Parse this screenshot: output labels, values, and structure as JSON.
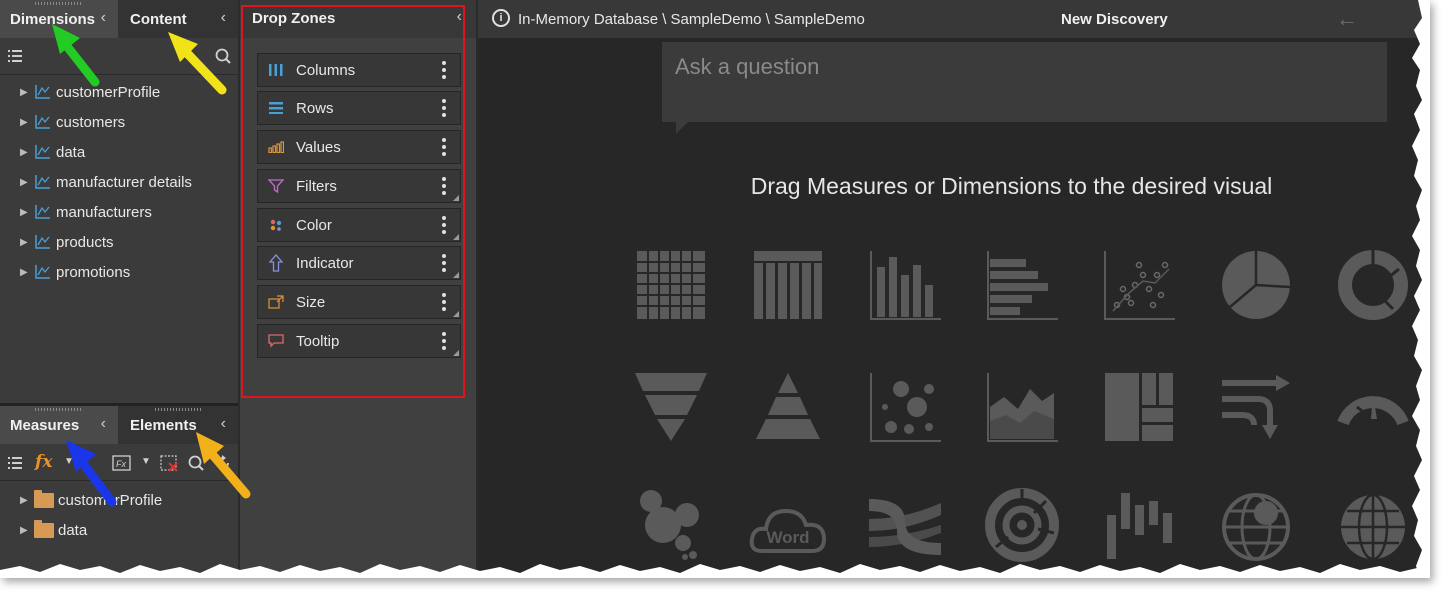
{
  "left_top_panel": {
    "tabs": [
      {
        "label": "Dimensions",
        "active": true
      },
      {
        "label": "Content",
        "active": false
      }
    ],
    "collapse_icon": "chevron-left-icon",
    "tools": [
      "list-icon",
      "search-icon"
    ],
    "tree": [
      {
        "label": "customerProfile",
        "icon": "dimension-icon"
      },
      {
        "label": "customers",
        "icon": "dimension-icon"
      },
      {
        "label": "data",
        "icon": "dimension-icon"
      },
      {
        "label": "manufacturer details",
        "icon": "dimension-icon"
      },
      {
        "label": "manufacturers",
        "icon": "dimension-icon"
      },
      {
        "label": "products",
        "icon": "dimension-icon"
      },
      {
        "label": "promotions",
        "icon": "dimension-icon"
      }
    ]
  },
  "left_bottom_panel": {
    "tabs": [
      {
        "label": "Measures",
        "active": true
      },
      {
        "label": "Elements",
        "active": false
      }
    ],
    "tools": [
      "list-icon",
      "fx-icon",
      "dropdown-icon",
      "fx-box-icon",
      "dropdown-icon",
      "delete-icon",
      "search-icon",
      "refresh-icon"
    ],
    "tree": [
      {
        "label": "customerProfile",
        "icon": "folder-icon"
      },
      {
        "label": "data",
        "icon": "folder-icon"
      }
    ]
  },
  "drop_zones": {
    "title": "Drop Zones",
    "zones": [
      {
        "label": "Columns",
        "icon": "columns-icon",
        "color": "#4a9fd8"
      },
      {
        "label": "Rows",
        "icon": "rows-icon",
        "color": "#4a9fd8"
      },
      {
        "label": "Values",
        "icon": "values-icon",
        "color": "#e0943a"
      },
      {
        "label": "Filters",
        "icon": "filter-icon",
        "color": "#c46ccf"
      },
      {
        "label": "Color",
        "icon": "color-icon",
        "color": "#d96b6b"
      },
      {
        "label": "Indicator",
        "icon": "indicator-icon",
        "color": "#8a8fe0"
      },
      {
        "label": "Size",
        "icon": "size-icon",
        "color": "#e0943a"
      },
      {
        "label": "Tooltip",
        "icon": "tooltip-icon",
        "color": "#e06a6a"
      }
    ]
  },
  "header": {
    "path": "In-Memory Database \\ SampleDemo \\ SampleDemo",
    "title": "New Discovery"
  },
  "ask": {
    "placeholder": "Ask a question"
  },
  "hint": "Drag Measures or Dimensions to the desired visual",
  "visuals": [
    "grid-icon",
    "pivot-icon",
    "column-chart-icon",
    "bar-chart-icon",
    "scatter-icon",
    "pie-icon",
    "donut-icon",
    "funnel-icon",
    "pyramid-icon",
    "bubble-icon",
    "area-icon",
    "treemap-icon",
    "flow-icon",
    "gauge-icon",
    "packed-bubble-icon",
    "word-cloud-icon",
    "sankey-icon",
    "sunburst-icon",
    "waterfall-icon",
    "globe-bubble-icon",
    "globe-icon"
  ],
  "word_cloud_text": "Word",
  "annotations": {
    "arrow_colors": [
      "#22cc22",
      "#f2e21a",
      "#1a36e8",
      "#f2b01a"
    ],
    "highlight_color": "#e0141e"
  }
}
